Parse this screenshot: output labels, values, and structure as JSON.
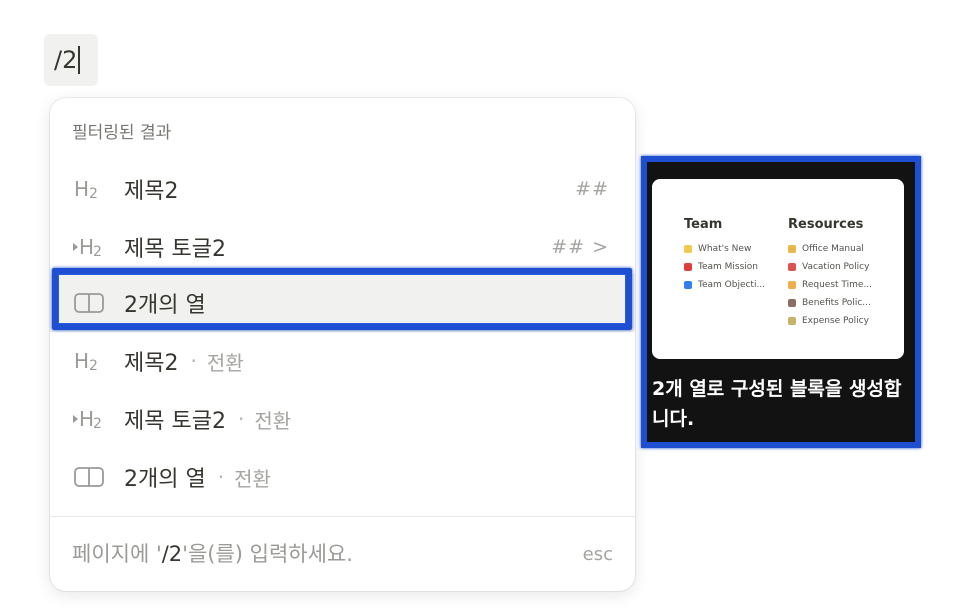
{
  "command": {
    "query": "/2"
  },
  "menu": {
    "section_label": "필터링된 결과",
    "items": [
      {
        "icon": "heading2-icon",
        "title": "제목2",
        "shortcut": "##"
      },
      {
        "icon": "toggle-heading2-icon",
        "title": "제목 토글2",
        "shortcut": "## >"
      },
      {
        "icon": "columns-icon",
        "title": "2개의 열",
        "selected": true
      },
      {
        "icon": "heading2-icon",
        "title": "제목2",
        "sep": "·",
        "sub": "전환"
      },
      {
        "icon": "toggle-heading2-icon",
        "title": "제목 토글2",
        "sep": "·",
        "sub": "전환"
      },
      {
        "icon": "columns-icon",
        "title": "2개의 열",
        "sep": "·",
        "sub": "전환"
      }
    ],
    "footer": {
      "prefix": "페이지에 '",
      "query": "/2",
      "suffix": "'을(를) 입력하세요.",
      "esc": "esc"
    }
  },
  "preview": {
    "columns": [
      {
        "heading": "Team",
        "rows": [
          "What's New",
          "Team Mission",
          "Team Objecti..."
        ]
      },
      {
        "heading": "Resources",
        "rows": [
          "Office Manual",
          "Vacation Policy",
          "Request Time...",
          "Benefits Polic...",
          "Expense Policy"
        ]
      }
    ],
    "description": "2개 열로 구성된 블록을 생성합니다."
  },
  "colors": {
    "highlight": "#1e4fd1",
    "selected_bg": "#f1f1ef",
    "text": "#37352f",
    "muted": "#9b9a97"
  }
}
